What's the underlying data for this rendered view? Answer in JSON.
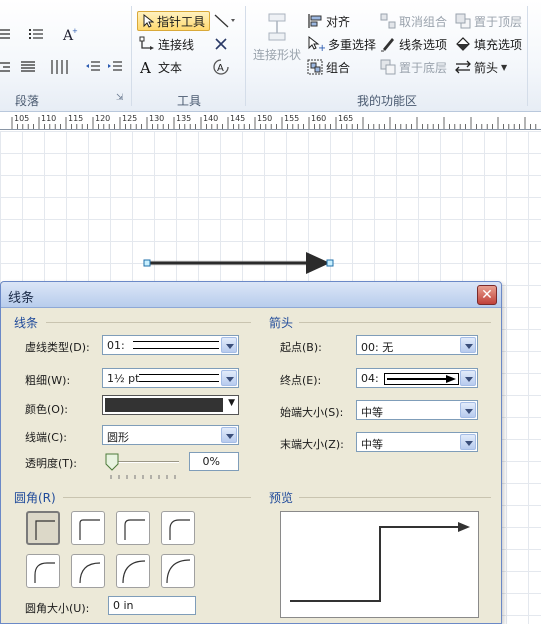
{
  "ribbon": {
    "paragraph_group": {
      "label": "段落",
      "launcher": "⇲"
    },
    "tools_group": {
      "label": "工具",
      "pointer": "指针工具",
      "connector": "连接线",
      "text": "文本"
    },
    "myfuncs_group": {
      "label": "我的功能区",
      "connect_shapes": "连接形状",
      "align": "对齐",
      "multi_select": "多重选择",
      "group": "组合",
      "ungroup": "取消组合",
      "line_options": "线条选项",
      "send_back": "置于底层",
      "bring_front": "置于顶层",
      "fill_options": "填充选项",
      "arrow": "箭头"
    }
  },
  "ruler": {
    "labels": [
      "105",
      "110",
      "115",
      "120",
      "125",
      "130",
      "135",
      "140",
      "145",
      "150",
      "155",
      "160",
      "165"
    ]
  },
  "dialog": {
    "title": "线条",
    "close": "✕",
    "line_section": {
      "title": "线条",
      "dash_label": "虚线类型(D):",
      "dash_value": "01:",
      "weight_label": "粗细(W):",
      "weight_value": "1½ pt",
      "color_label": "颜色(O):",
      "cap_label": "线端(C):",
      "cap_value": "圆形",
      "transparency_label": "透明度(T):",
      "transparency_value": "0%"
    },
    "arrow_section": {
      "title": "箭头",
      "begin_label": "起点(B):",
      "begin_value": "00: 无",
      "end_label": "终点(E):",
      "end_value": "04:",
      "begin_size_label": "始端大小(S):",
      "begin_size_value": "中等",
      "end_size_label": "末端大小(Z):",
      "end_size_value": "中等"
    },
    "rounding_section": {
      "title": "圆角(R)",
      "size_label": "圆角大小(U):",
      "size_value": "0 in"
    },
    "preview_section": {
      "title": "预览"
    }
  },
  "colors": {
    "line_color": "#333333",
    "accent": "#1f4a9a"
  }
}
